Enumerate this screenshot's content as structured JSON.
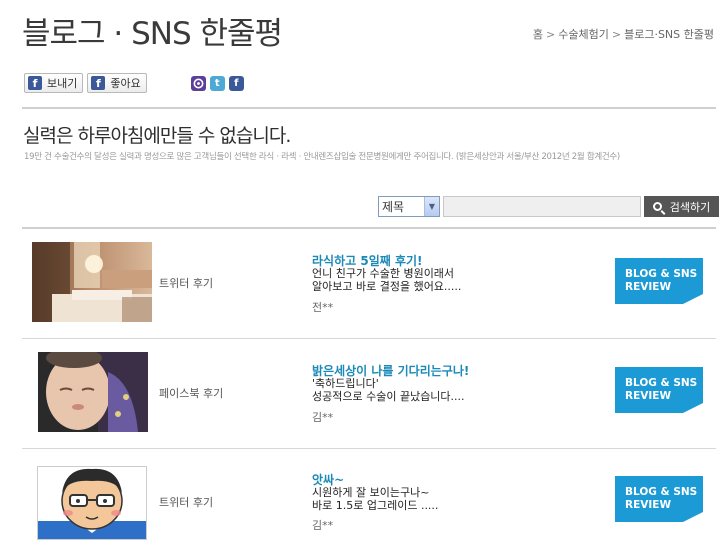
{
  "header": {
    "title": "블로그 · SNS 한줄평",
    "breadcrumb": [
      "홈",
      "수술체험기",
      "블로그·SNS 한줄평"
    ]
  },
  "social": {
    "share_label": "보내기",
    "like_label": "좋아요",
    "icons": [
      "me2day-icon",
      "twitter-icon",
      "facebook-icon"
    ],
    "colors": {
      "facebook": "#3b5998",
      "twitter": "#4ea9d7",
      "me2day": "#5b3f9a"
    }
  },
  "intro": {
    "slogan": "실력은 하루아침에만들 수 없습니다.",
    "subtext": "19만 건 수술건수의 달성은 실력과 명성으로 많은 고객님들이 선택한 라식 · 라섹 · 안내렌즈삽입술 전문병원에게만 주어집니다. (밝은세상안과 서울/부산 2012년 2월 합계건수)"
  },
  "search": {
    "select_value": "제목",
    "button_label": "검색하기"
  },
  "reviews": [
    {
      "source": "트위터 후기",
      "title": "라식하고 5일째 후기!",
      "body": [
        "언니 친구가 수술한 병원이래서",
        "알아보고 바로 결정을 했어요....."
      ],
      "author": "전**",
      "button": [
        "BLOG & SNS",
        "REVIEW"
      ]
    },
    {
      "source": "페이스북 후기",
      "title": "밝은세상이 나를 기다리는구나!",
      "body": [
        "'축하드립니다'",
        "성공적으로 수술이 끝났습니다...."
      ],
      "author": "김**",
      "button": [
        "BLOG & SNS",
        "REVIEW"
      ]
    },
    {
      "source": "트위터 후기",
      "title": "앗싸~",
      "body": [
        "시원하게 잘 보이는구나~",
        "바로 1.5로 업그레이드 ....."
      ],
      "author": "김**",
      "button": [
        "BLOG & SNS",
        "REVIEW"
      ]
    }
  ],
  "accent_color": "#1c9ad6"
}
